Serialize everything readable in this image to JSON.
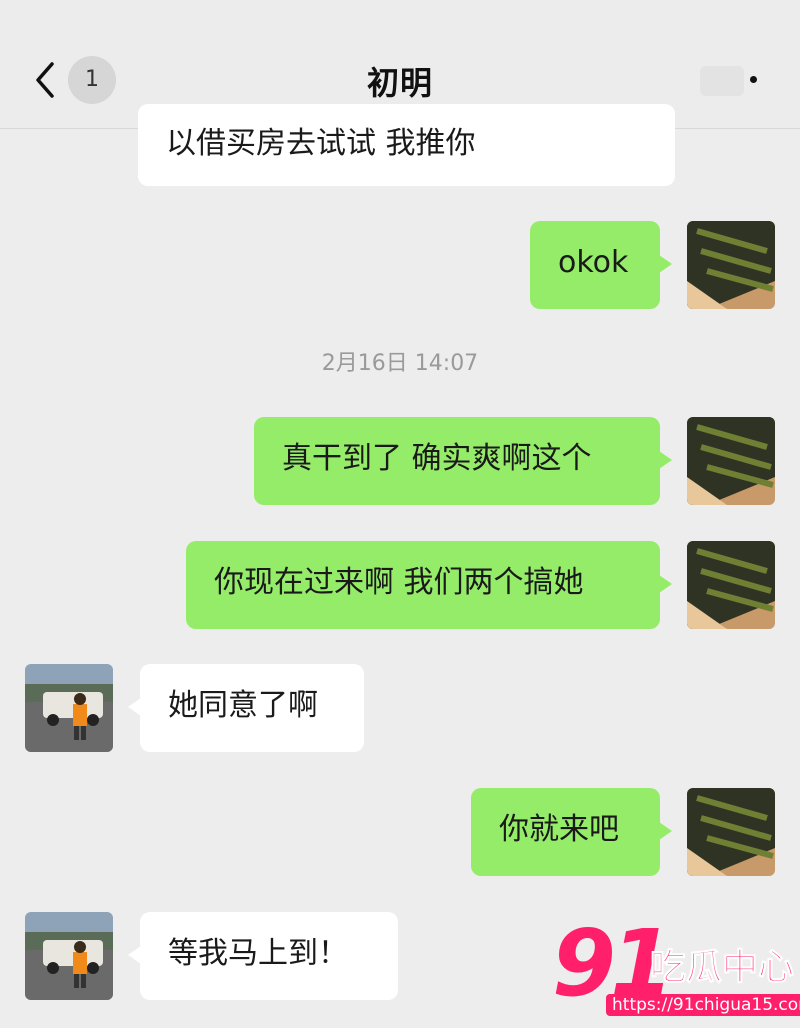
{
  "header": {
    "title": "初明",
    "unread_count": "1"
  },
  "messages": [
    {
      "side": "in",
      "text": "以借买房去试试 我推你"
    },
    {
      "side": "out",
      "text": "okok"
    },
    {
      "side": "out",
      "text": "真干到了 确实爽啊这个"
    },
    {
      "side": "out",
      "text": "你现在过来啊 我们两个搞她"
    },
    {
      "side": "in",
      "text": "她同意了啊"
    },
    {
      "side": "out",
      "text": "你就来吧"
    },
    {
      "side": "in",
      "text": "等我马上到！"
    }
  ],
  "timestamp": "2月16日 14:07",
  "watermark": {
    "number": "91",
    "name": "吃瓜中心",
    "url": "https://91chigua15.com"
  },
  "colors": {
    "background": "#ededed",
    "outgoing_bubble": "#95ec69",
    "incoming_bubble": "#ffffff",
    "watermark": "#ff1f6b"
  },
  "icons": {
    "back": "chevron-left-icon",
    "more": "more-dots-icon"
  }
}
